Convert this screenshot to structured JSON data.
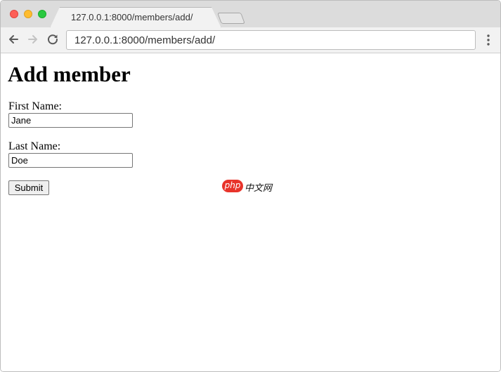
{
  "browser": {
    "tab_title": "127.0.0.1:8000/members/add/",
    "address": "127.0.0.1:8000/members/add/",
    "icons": {
      "back": "arrow-left-icon",
      "forward": "arrow-right-icon",
      "reload": "reload-icon",
      "menu": "kebab-menu-icon"
    }
  },
  "page": {
    "title": "Add member",
    "form": {
      "first_name_label": "First Name:",
      "first_name_value": "Jane",
      "last_name_label": "Last Name:",
      "last_name_value": "Doe",
      "submit_label": "Submit"
    }
  },
  "watermark": {
    "badge": "php",
    "text": "中文网",
    "color": "#e8332a"
  },
  "colors": {
    "tabstrip": "#dcdcdc",
    "toolbar": "#f2f2f2",
    "traffic_red": "#fd5f57",
    "traffic_yellow": "#febc2e",
    "traffic_green": "#29c840"
  }
}
